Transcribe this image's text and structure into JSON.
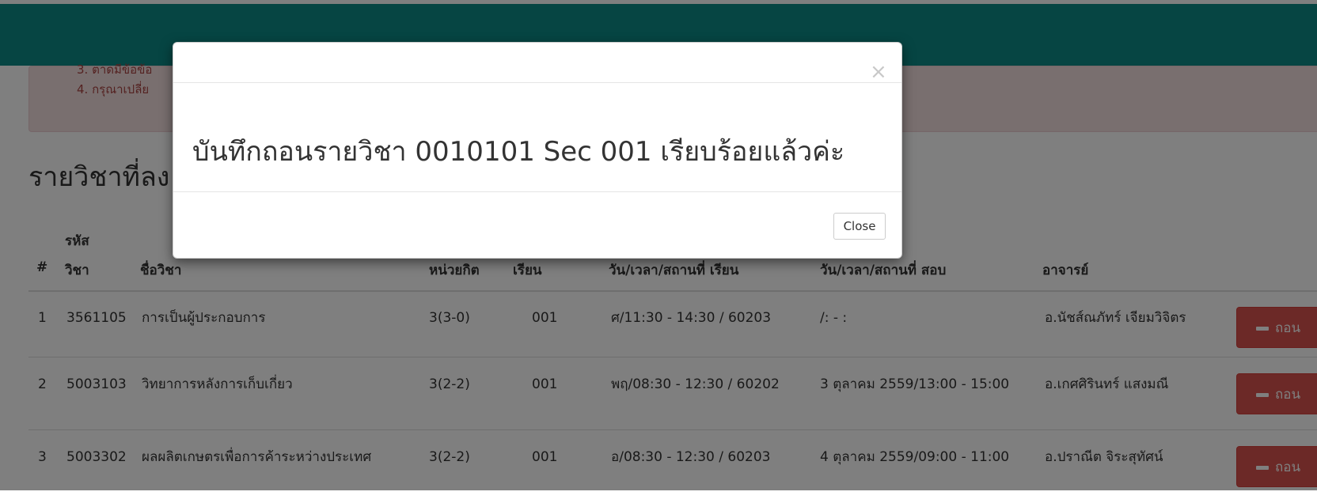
{
  "alert": {
    "line3": "3. ตาดมีข้อข้อ",
    "line4": "4. กรุณาเปลี่ย"
  },
  "section_title": "รายวิชาที่ลง",
  "table": {
    "headers": {
      "num": "#",
      "code_top": "รหัส",
      "code_bottom": "วิชา",
      "name": "ชื่อวิชา",
      "credit": "หน่วยกิต",
      "sec": "เรียน",
      "class_time": "วัน/เวลา/สถานที่ เรียน",
      "exam_time": "วัน/เวลา/สถานที่ สอบ",
      "teacher": "อาจารย์"
    },
    "rows": [
      {
        "num": "1",
        "code": "3561105",
        "name": "การเป็นผู้ประกอบการ",
        "credit": "3(3-0)",
        "sec": "001",
        "class_time": "ศ/11:30 - 14:30 / 60203",
        "exam_time": "/: - :",
        "teacher": "อ.นัชส์ณภัทร์ เจียมวิจิตร",
        "action": "ถอน"
      },
      {
        "num": "2",
        "code": "5003103",
        "name": "วิทยาการหลังการเก็บเกี่ยว",
        "credit": "3(2-2)",
        "sec": "001",
        "class_time": "พฤ/08:30 - 12:30 / 60202",
        "exam_time": "3 ตุลาคม 2559/13:00 - 15:00",
        "teacher": "อ.เกศศิรินทร์ แสงมณี",
        "action": "ถอน"
      },
      {
        "num": "3",
        "code": "5003302",
        "name": "ผลผลิตเกษตรเพื่อการค้าระหว่างประเทศ",
        "credit": "3(2-2)",
        "sec": "001",
        "class_time": "อ/08:30 - 12:30 / 60203",
        "exam_time": "4 ตุลาคม 2559/09:00 - 11:00",
        "teacher": "อ.ปราณีต จิระสุทัศน์",
        "action": "ถอน"
      }
    ]
  },
  "modal": {
    "close_x": "×",
    "message": "บันทึกถอนรายวิชา 0010101 Sec 001 เรียบร้อยแล้วค่ะ",
    "close_label": "Close"
  },
  "colors": {
    "topbar": "#0c8a87",
    "danger": "#d9534f",
    "alert_bg": "#f2dede"
  }
}
